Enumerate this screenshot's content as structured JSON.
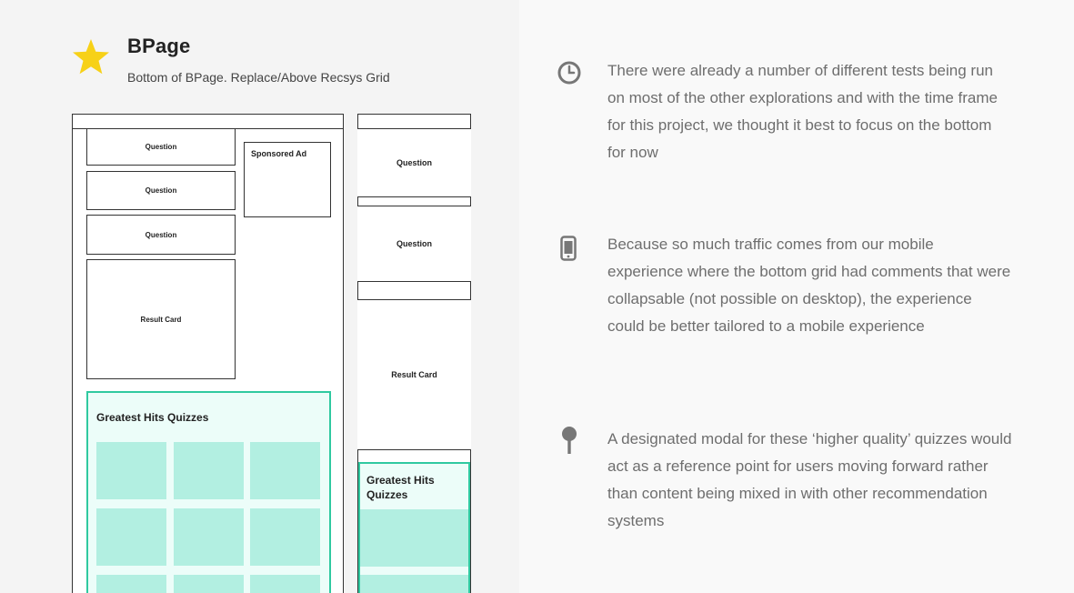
{
  "header": {
    "title": "BPage",
    "subtitle": "Bottom of BPage. Replace/Above Recsys Grid",
    "icon": "star-icon",
    "icon_color": "#f7d118"
  },
  "desktop_wireframe": {
    "questions": [
      "Question",
      "Question",
      "Question"
    ],
    "sponsored_ad": "Sponsored Ad",
    "result_card": "Result Card",
    "greatest_hits_title": "Greatest Hits Quizzes"
  },
  "mobile_wireframe": {
    "questions": [
      "Question",
      "Question"
    ],
    "result_card": "Result Card",
    "greatest_hits_title_line1": "Greatest Hits",
    "greatest_hits_title_line2": "Quizzes"
  },
  "colors": {
    "accent_border": "#2fc9a0",
    "accent_fill": "#b2efe1",
    "accent_bg": "#ecfdf9",
    "icon_gray": "#777777",
    "text_gray": "#6e6e6e"
  },
  "notes": [
    {
      "icon": "clock-icon",
      "text": "There were already a number of different tests being run on most of the other explorations and with the time frame for this project, we thought it best to focus on the bottom for now"
    },
    {
      "icon": "mobile-phone-icon",
      "text": "Because so much traffic comes from our mobile experience where the bottom grid had comments that were collapsable (not possible on desktop), the experience could be better tailored to a mobile experience"
    },
    {
      "icon": "pin-icon",
      "text": "A designated modal for these ‘higher quality’ quizzes would act as a reference point for users moving forward rather than content being mixed in with other recommendation systems"
    }
  ]
}
